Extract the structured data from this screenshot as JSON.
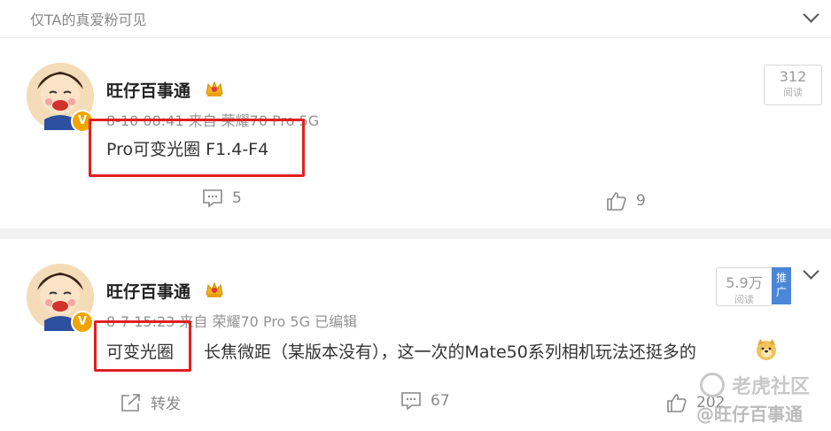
{
  "top": {
    "visibility": "仅TA的真爱粉可见"
  },
  "posts": [
    {
      "username": "旺仔百事通",
      "meta": "8-10 08:41  来自 荣耀70 Pro 5G",
      "content_highlight": "Pro可变光圈 F1.4-F4",
      "content_rest": "",
      "read_count": "312",
      "read_label": "阅读",
      "comment_count": "5",
      "like_count": "9"
    },
    {
      "username": "旺仔百事通",
      "meta": "8-7 15:23  来自 荣耀70 Pro 5G 已编辑",
      "content_highlight": "可变光圈",
      "content_rest": "长焦微距（某版本没有），这一次的Mate50系列相机玩法还挺多的",
      "read_count": "5.9万",
      "read_label": "阅读",
      "promote_label": "推广",
      "repost_label": "转发",
      "comment_count": "67",
      "like_count": "202"
    }
  ],
  "watermark": {
    "line1": "老虎社区",
    "line2": "@旺仔百事通"
  },
  "colors": {
    "highlight_box": "#e02020",
    "vip_badge": "#f0a400",
    "promote": "#4b87d6"
  }
}
